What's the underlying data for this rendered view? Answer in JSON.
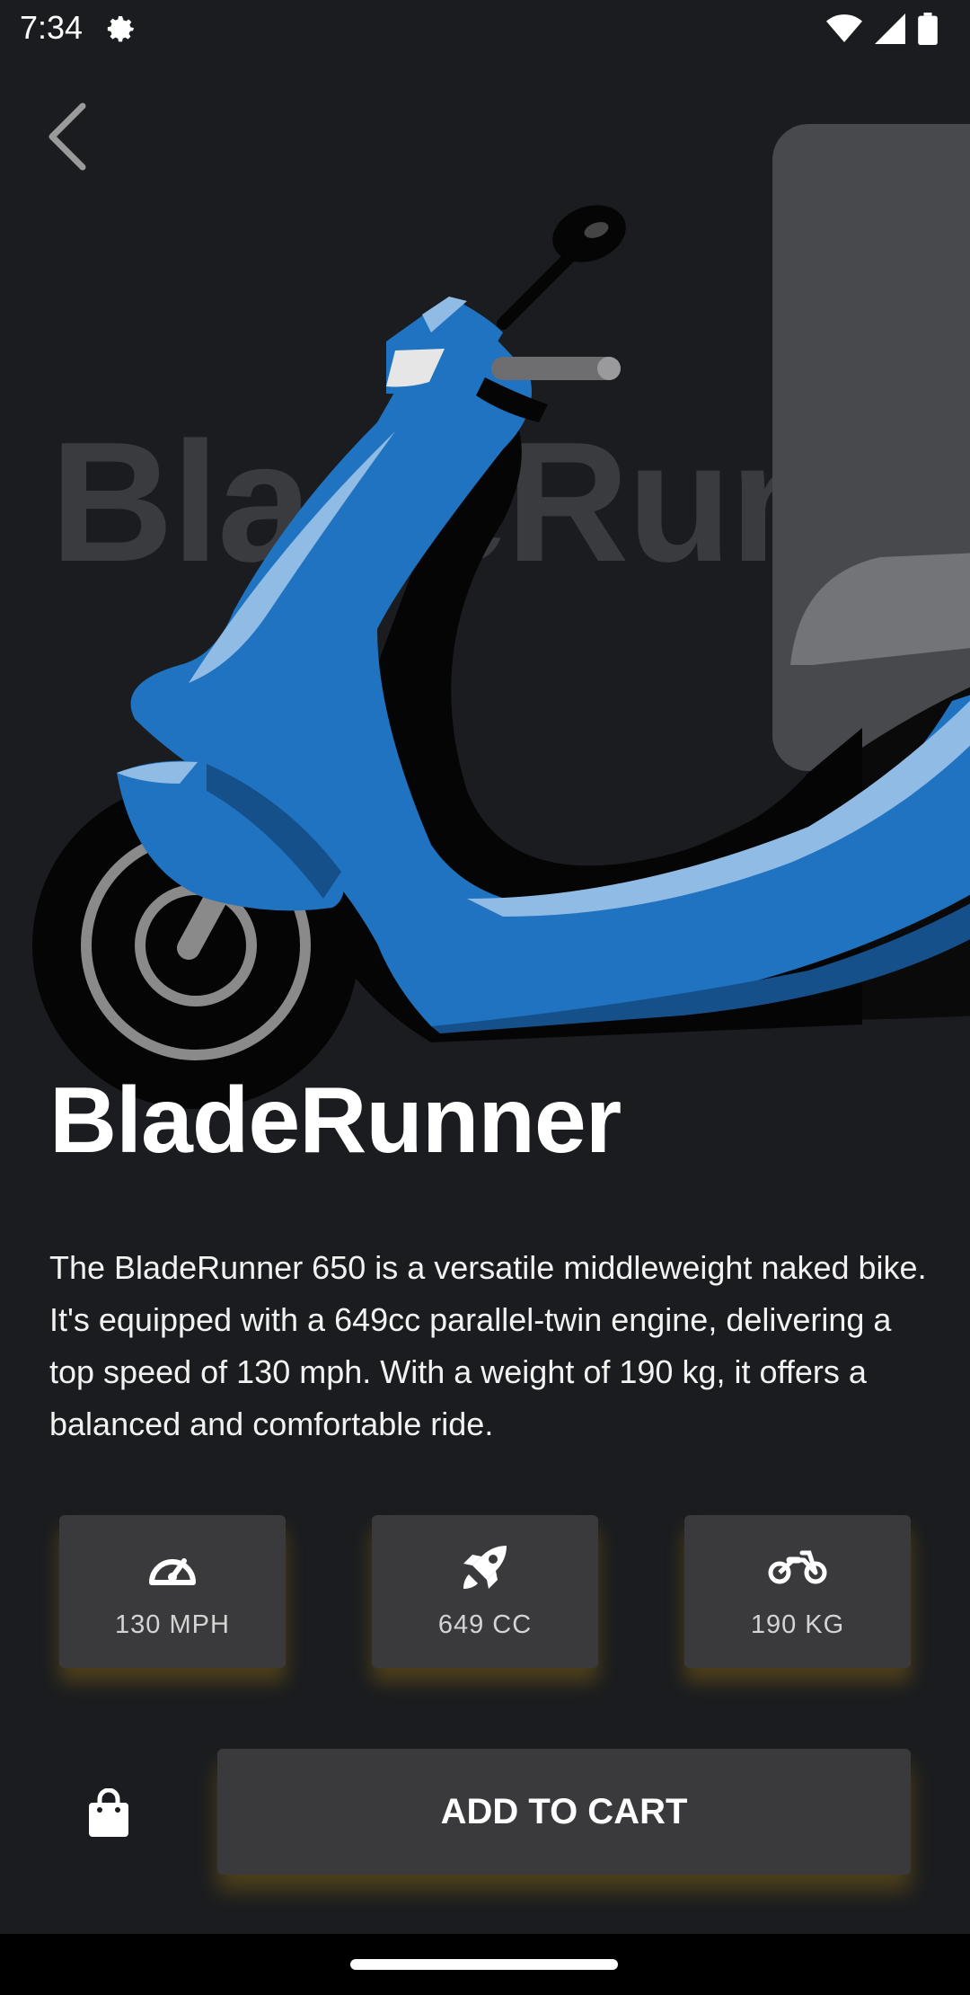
{
  "status": {
    "time": "7:34"
  },
  "product": {
    "watermark": "BladeRunner",
    "title": "BladeRunner",
    "description": "The BladeRunner 650 is a versatile middleweight naked bike. It's equipped with a 649cc parallel-twin engine, delivering a top speed of 130 mph. With a weight of 190 kg, it offers a balanced and comfortable ride."
  },
  "specs": [
    {
      "icon": "speedometer-icon",
      "label": "130 MPH"
    },
    {
      "icon": "rocket-icon",
      "label": "649 CC"
    },
    {
      "icon": "motorcycle-icon",
      "label": "190 KG"
    }
  ],
  "actions": {
    "cart_label": "ADD TO CART"
  },
  "colors": {
    "background": "#1a1c1f",
    "card": "#3a3a3c",
    "scooter_blue": "#1f73c1",
    "glow": "#be8c14"
  }
}
